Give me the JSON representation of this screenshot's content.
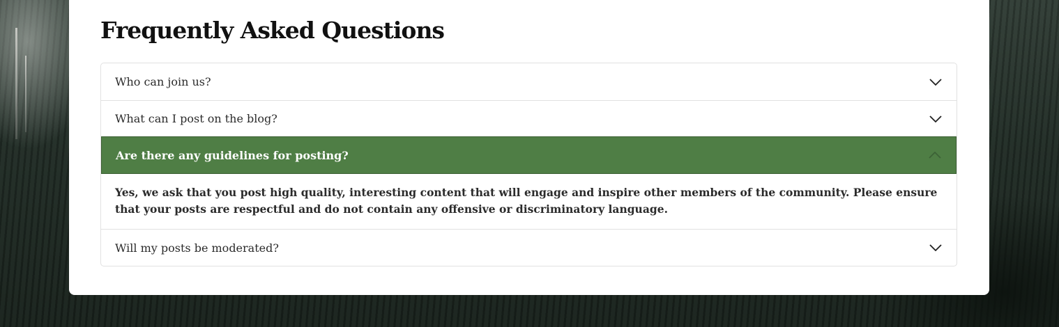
{
  "faq": {
    "title": "Frequently Asked Questions",
    "items": [
      {
        "question": "Who can join us?",
        "expanded": false
      },
      {
        "question": "What can I post on the blog?",
        "expanded": false
      },
      {
        "question": "Are there any guidelines for posting?",
        "expanded": true,
        "answer": "Yes, we ask that you post high quality, interesting content that will engage and inspire other members of the community. Please ensure that your posts are respectful and do not contain any offensive or discriminatory language."
      },
      {
        "question": "Will my posts be moderated?",
        "expanded": false
      }
    ]
  },
  "colors": {
    "accent": "#4f7e45",
    "card": "#ffffff",
    "border": "#e1e1e1",
    "text": "#2b2b2b"
  },
  "icons": {
    "collapsed": "chevron-down-icon",
    "expanded": "chevron-up-icon"
  }
}
